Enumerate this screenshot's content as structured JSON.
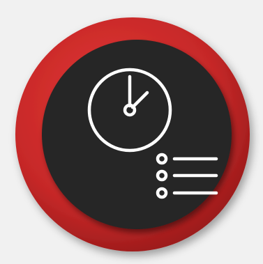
{
  "app_icon": {
    "name": "clock-with-list-icon",
    "glyphs": [
      "clock-icon",
      "list-icon"
    ],
    "colors": {
      "background": "#f1f1f1",
      "outer_ring": "#c62828",
      "outer_ring_shadow": "#8e1717",
      "inner_disc": "#262626",
      "glyph": "#ffffff"
    }
  }
}
